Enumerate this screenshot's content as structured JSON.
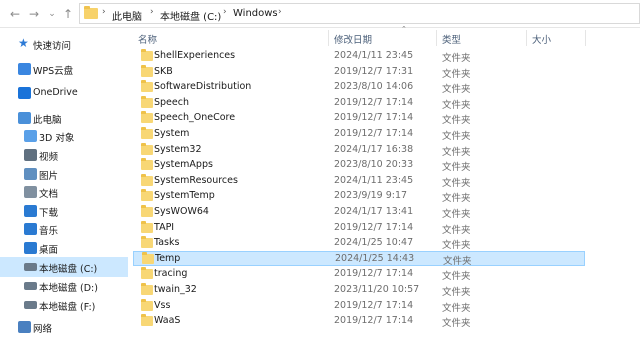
{
  "breadcrumb": [
    "此电脑",
    "本地磁盘 (C:)",
    "Windows"
  ],
  "sidebar": {
    "items": [
      {
        "label": "快速访问",
        "icon": "star-icon",
        "color": "#2e7bd6"
      },
      {
        "label": "WPS云盘",
        "icon": "cloud-icon",
        "color": "#3a86e0"
      },
      {
        "label": "OneDrive",
        "icon": "onedrive-icon",
        "color": "#1a73d9"
      },
      {
        "label": "此电脑",
        "icon": "computer-icon",
        "color": "#4a90d9"
      },
      {
        "label": "3D 对象",
        "icon": "cube-icon",
        "color": "#5aa0e8"
      },
      {
        "label": "视频",
        "icon": "video-icon",
        "color": "#607080"
      },
      {
        "label": "图片",
        "icon": "image-icon",
        "color": "#5f8fc0"
      },
      {
        "label": "文档",
        "icon": "document-icon",
        "color": "#8090a0"
      },
      {
        "label": "下载",
        "icon": "download-icon",
        "color": "#2a7ad2"
      },
      {
        "label": "音乐",
        "icon": "music-icon",
        "color": "#2a7ad2"
      },
      {
        "label": "桌面",
        "icon": "desktop-icon",
        "color": "#2a7ad2"
      },
      {
        "label": "本地磁盘 (C:)",
        "icon": "drive-icon",
        "color": "#6a7a8a"
      },
      {
        "label": "本地磁盘 (D:)",
        "icon": "drive-icon",
        "color": "#6a7a8a"
      },
      {
        "label": "本地磁盘 (F:)",
        "icon": "drive-icon",
        "color": "#6a7a8a"
      },
      {
        "label": "网络",
        "icon": "network-icon",
        "color": "#4a80c0"
      }
    ]
  },
  "columns": {
    "name": "名称",
    "date": "修改日期",
    "type": "类型",
    "size": "大小"
  },
  "files": [
    {
      "name": "ShellExperiences",
      "date": "2024/1/11 23:45",
      "type": "文件夹"
    },
    {
      "name": "SKB",
      "date": "2019/12/7 17:31",
      "type": "文件夹"
    },
    {
      "name": "SoftwareDistribution",
      "date": "2023/8/10 14:06",
      "type": "文件夹"
    },
    {
      "name": "Speech",
      "date": "2019/12/7 17:14",
      "type": "文件夹"
    },
    {
      "name": "Speech_OneCore",
      "date": "2019/12/7 17:14",
      "type": "文件夹"
    },
    {
      "name": "System",
      "date": "2019/12/7 17:14",
      "type": "文件夹"
    },
    {
      "name": "System32",
      "date": "2024/1/17 16:38",
      "type": "文件夹"
    },
    {
      "name": "SystemApps",
      "date": "2023/8/10 20:33",
      "type": "文件夹"
    },
    {
      "name": "SystemResources",
      "date": "2024/1/11 23:45",
      "type": "文件夹"
    },
    {
      "name": "SystemTemp",
      "date": "2023/9/19 9:17",
      "type": "文件夹"
    },
    {
      "name": "SysWOW64",
      "date": "2024/1/17 13:41",
      "type": "文件夹"
    },
    {
      "name": "TAPI",
      "date": "2019/12/7 17:14",
      "type": "文件夹"
    },
    {
      "name": "Tasks",
      "date": "2024/1/25 10:47",
      "type": "文件夹"
    },
    {
      "name": "Temp",
      "date": "2024/1/25 14:43",
      "type": "文件夹"
    },
    {
      "name": "tracing",
      "date": "2019/12/7 17:14",
      "type": "文件夹"
    },
    {
      "name": "twain_32",
      "date": "2023/11/20 10:57",
      "type": "文件夹"
    },
    {
      "name": "Vss",
      "date": "2019/12/7 17:14",
      "type": "文件夹"
    },
    {
      "name": "WaaS",
      "date": "2019/12/7 17:14",
      "type": "文件夹"
    }
  ]
}
